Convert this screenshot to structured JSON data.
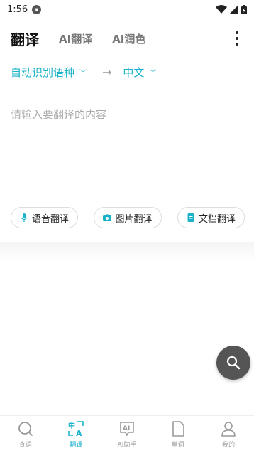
{
  "status": {
    "time": "1:56"
  },
  "tabs": [
    {
      "label": "翻译"
    },
    {
      "label": "AI翻译"
    },
    {
      "label": "AI润色"
    }
  ],
  "lang": {
    "source": "自动识别语种",
    "target": "中文"
  },
  "input": {
    "placeholder": "请输入要翻译的内容"
  },
  "actions": {
    "voice": "语音翻译",
    "image": "图片翻译",
    "doc": "文档翻译"
  },
  "nav": [
    {
      "label": "查词"
    },
    {
      "label": "翻译"
    },
    {
      "label": "AI助手"
    },
    {
      "label": "单词"
    },
    {
      "label": "我的"
    }
  ],
  "colors": {
    "accent": "#1ab2c9",
    "fab": "#555555"
  }
}
